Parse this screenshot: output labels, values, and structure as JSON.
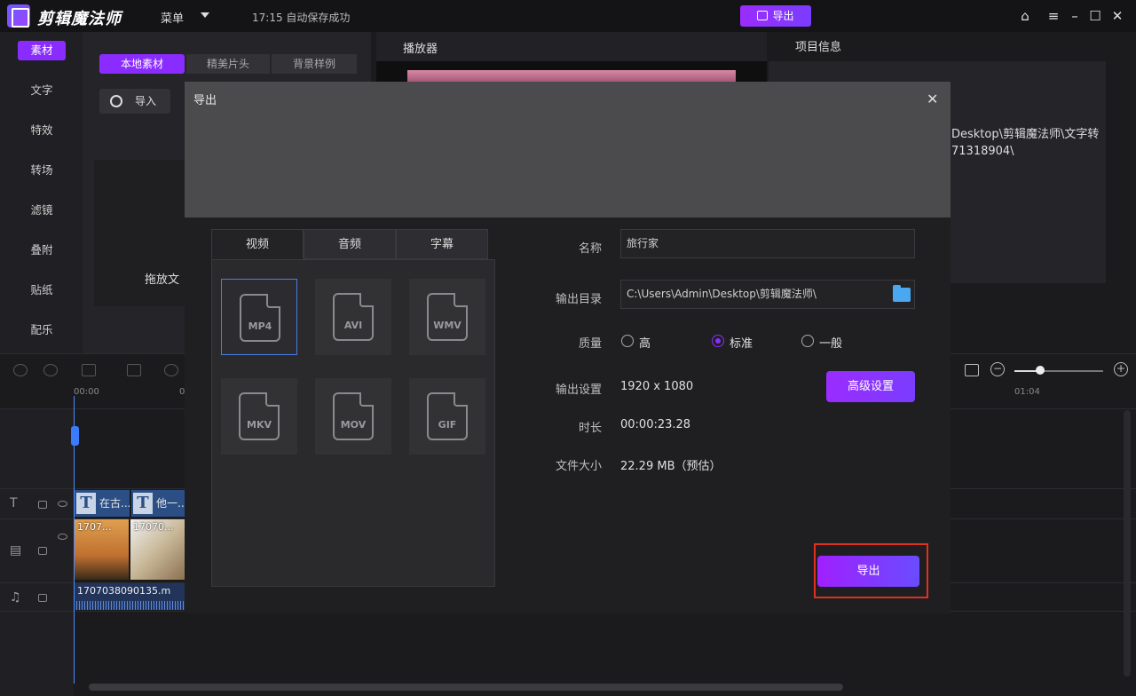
{
  "app": {
    "name": "剪辑魔法师",
    "menu": "菜单",
    "autosave": "17:15 自动保存成功",
    "export_button": "导出",
    "window_controls": [
      "home-icon",
      "hamburger-icon",
      "minimize-icon",
      "maximize-icon",
      "close-icon"
    ]
  },
  "sidebar": {
    "items": [
      "素材",
      "文字",
      "特效",
      "转场",
      "滤镜",
      "叠附",
      "贴纸",
      "配乐"
    ],
    "active": "素材"
  },
  "media": {
    "tabs": [
      "本地素材",
      "精美片头",
      "背景样例"
    ],
    "import": "导入",
    "drop_hint": "拖放文"
  },
  "player": {
    "title": "播放器"
  },
  "project_info": {
    "title": "项目信息",
    "path_line1": "Desktop\\剪辑魔法师\\文字转",
    "path_line2": "71318904\\"
  },
  "timeline": {
    "ruler": [
      "00:00",
      "0",
      "01:04"
    ],
    "text_clips": [
      "在古...",
      "他一..."
    ],
    "image_clips": [
      "1707...",
      "17070..."
    ],
    "audio_clip": "1707038090135.m"
  },
  "export_dialog": {
    "title": "导出",
    "format_tabs": [
      "视频",
      "音频",
      "字幕"
    ],
    "formats": [
      "MP4",
      "AVI",
      "WMV",
      "MKV",
      "MOV",
      "GIF"
    ],
    "selected_format": "MP4",
    "name_label": "名称",
    "name_value": "旅行家",
    "dir_label": "输出目录",
    "dir_value": "C:\\Users\\Admin\\Desktop\\剪辑魔法师\\",
    "quality_label": "质量",
    "quality_options": [
      "高",
      "标准",
      "一般"
    ],
    "quality_selected": "标准",
    "settings_label": "输出设置",
    "settings_value": "1920 x 1080",
    "advanced_button": "高级设置",
    "duration_label": "时长",
    "duration_value": "00:00:23.28",
    "size_label": "文件大小",
    "size_value": "22.29 MB（预估）",
    "export_button": "导出"
  },
  "colors": {
    "accent": "#8a2cff",
    "highlight_box": "#e0301e",
    "selected_format_border": "#4a7de0"
  }
}
